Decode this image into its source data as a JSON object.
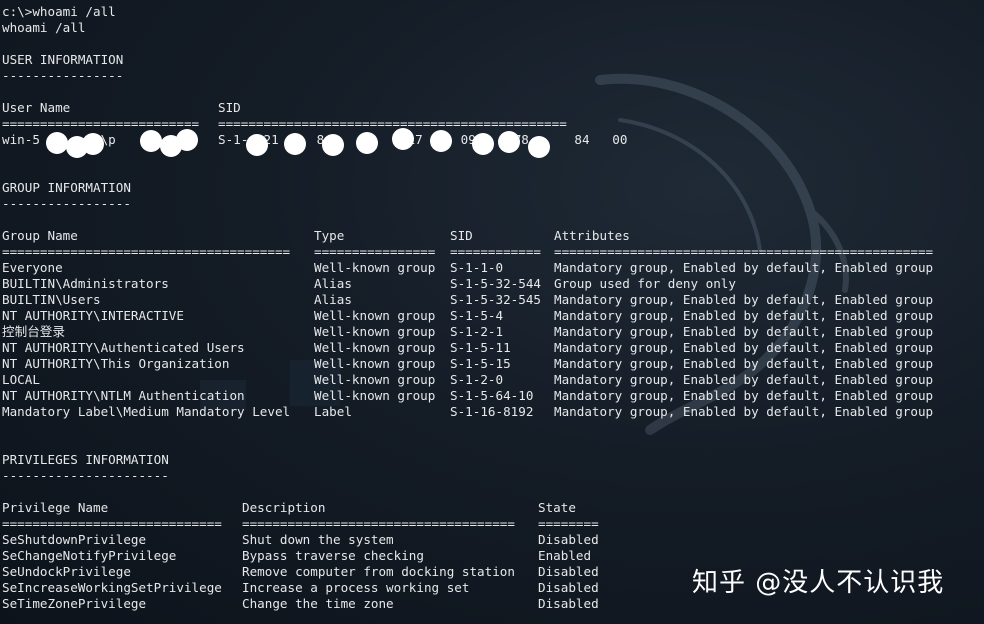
{
  "terminal": {
    "prompt_line": "c:\\>whoami /all",
    "echo_line": "whoami /all"
  },
  "user_info": {
    "heading": "USER INFORMATION",
    "underline": "----------------",
    "col_user": "User Name",
    "col_sid": "SID",
    "sep_user": "==========================",
    "sep_sid": "==============================================",
    "user_name": "win-5      60\\p     b",
    "sid": "S-1-  21     84    09    17     09     78      84   00"
  },
  "group_info": {
    "heading": "GROUP INFORMATION",
    "underline": "-----------------",
    "headers": [
      "Group Name",
      "Type",
      "SID",
      "Attributes"
    ],
    "separators": [
      "======================================",
      "================",
      "============",
      "=================================================="
    ],
    "rows": [
      {
        "name": "Everyone",
        "type": "Well-known group",
        "sid": "S-1-1-0",
        "attr": "Mandatory group, Enabled by default, Enabled group"
      },
      {
        "name": "BUILTIN\\Administrators",
        "type": "Alias",
        "sid": "S-1-5-32-544",
        "attr": "Group used for deny only"
      },
      {
        "name": "BUILTIN\\Users",
        "type": "Alias",
        "sid": "S-1-5-32-545",
        "attr": "Mandatory group, Enabled by default, Enabled group"
      },
      {
        "name": "NT AUTHORITY\\INTERACTIVE",
        "type": "Well-known group",
        "sid": "S-1-5-4",
        "attr": "Mandatory group, Enabled by default, Enabled group"
      },
      {
        "name": "控制台登录",
        "type": "Well-known group",
        "sid": "S-1-2-1",
        "attr": "Mandatory group, Enabled by default, Enabled group"
      },
      {
        "name": "NT AUTHORITY\\Authenticated Users",
        "type": "Well-known group",
        "sid": "S-1-5-11",
        "attr": "Mandatory group, Enabled by default, Enabled group"
      },
      {
        "name": "NT AUTHORITY\\This Organization",
        "type": "Well-known group",
        "sid": "S-1-5-15",
        "attr": "Mandatory group, Enabled by default, Enabled group"
      },
      {
        "name": "LOCAL",
        "type": "Well-known group",
        "sid": "S-1-2-0",
        "attr": "Mandatory group, Enabled by default, Enabled group"
      },
      {
        "name": "NT AUTHORITY\\NTLM Authentication",
        "type": "Well-known group",
        "sid": "S-1-5-64-10",
        "attr": "Mandatory group, Enabled by default, Enabled group"
      },
      {
        "name": "Mandatory Label\\Medium Mandatory Level",
        "type": "Label",
        "sid": "S-1-16-8192",
        "attr": "Mandatory group, Enabled by default, Enabled group"
      }
    ]
  },
  "privileges_info": {
    "heading": "PRIVILEGES INFORMATION",
    "underline": "----------------------",
    "headers": [
      "Privilege Name",
      "Description",
      "State"
    ],
    "separators": [
      "=============================",
      "====================================",
      "========"
    ],
    "rows": [
      {
        "name": "SeShutdownPrivilege",
        "desc": "Shut down the system",
        "state": "Disabled"
      },
      {
        "name": "SeChangeNotifyPrivilege",
        "desc": "Bypass traverse checking",
        "state": "Enabled"
      },
      {
        "name": "SeUndockPrivilege",
        "desc": "Remove computer from docking station",
        "state": "Disabled"
      },
      {
        "name": "SeIncreaseWorkingSetPrivilege",
        "desc": "Increase a process working set",
        "state": "Disabled"
      },
      {
        "name": "SeTimeZonePrivilege",
        "desc": "Change the time zone",
        "state": "Disabled"
      }
    ]
  },
  "watermark": {
    "text": "知乎 @没人不认识我"
  }
}
